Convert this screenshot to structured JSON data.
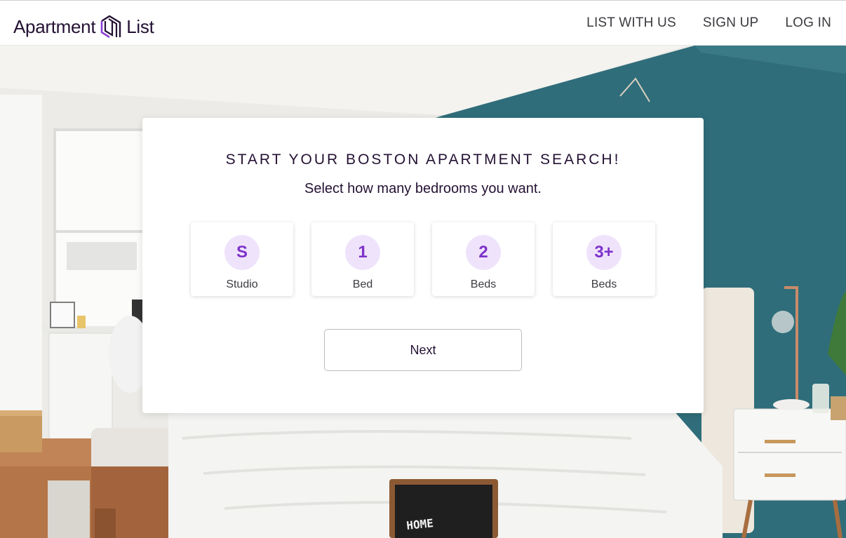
{
  "header": {
    "brand_left": "Apartment",
    "brand_right": "List",
    "nav": {
      "list_with_us": "LIST WITH US",
      "sign_up": "SIGN UP",
      "log_in": "LOG IN"
    }
  },
  "card": {
    "title": "START YOUR BOSTON APARTMENT SEARCH!",
    "subtitle": "Select how many bedrooms you want.",
    "options": [
      {
        "symbol": "S",
        "label": "Studio"
      },
      {
        "symbol": "1",
        "label": "Bed"
      },
      {
        "symbol": "2",
        "label": "Beds"
      },
      {
        "symbol": "3+",
        "label": "Beds"
      }
    ],
    "next_label": "Next"
  },
  "background": {
    "letterboard_text": "HOME"
  },
  "colors": {
    "accent": "#7d32c9",
    "accent_light": "#efe3fb",
    "text_dark": "#241133",
    "wall_teal": "#2f6d7a"
  }
}
